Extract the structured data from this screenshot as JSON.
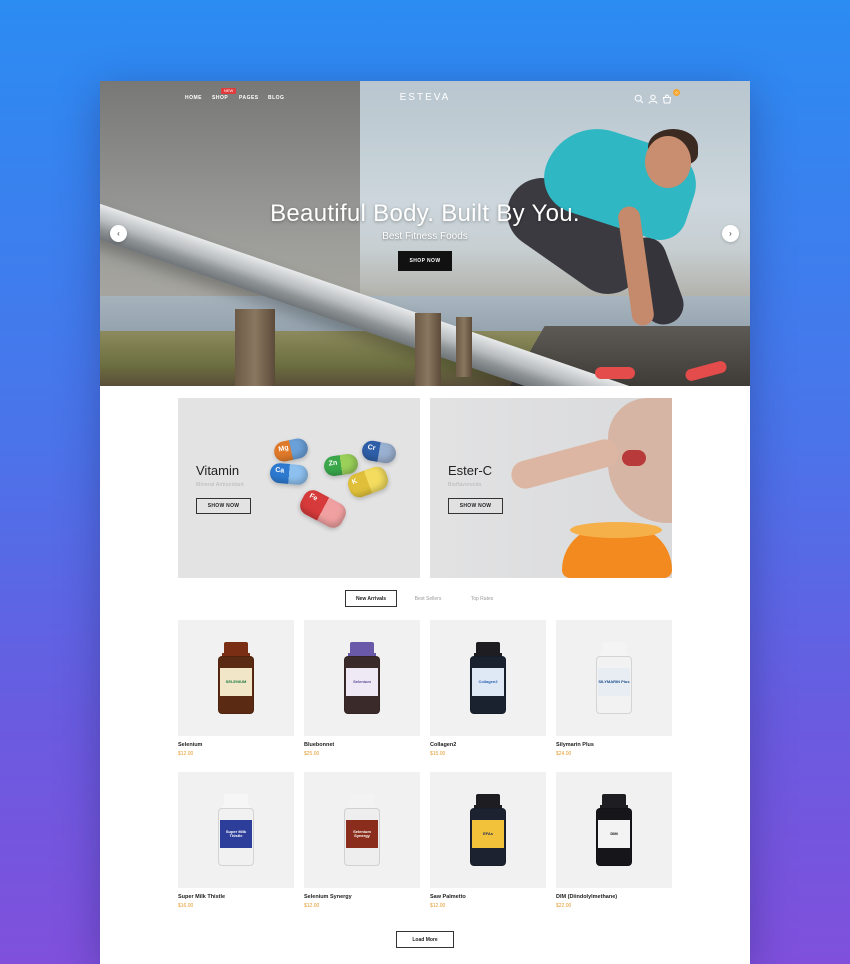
{
  "brand": "ESTEVA",
  "nav": {
    "items": [
      {
        "label": "HOME"
      },
      {
        "label": "SHOP",
        "badge": "NEW"
      },
      {
        "label": "PAGES"
      },
      {
        "label": "BLOG"
      }
    ],
    "icons": [
      "search-icon",
      "user-icon",
      "cart-icon"
    ],
    "cart_count": "0"
  },
  "hero": {
    "title": "Beautiful Body. Built By You.",
    "subtitle": "Best Fitness Foods",
    "button": "SHOP NOW",
    "prev_arrow": "‹",
    "next_arrow": "›"
  },
  "promos": [
    {
      "title": "Vitamin",
      "subtitle": "Mineral Antioxidant",
      "button": "SHOW NOW",
      "pill_labels": [
        "Ca",
        "Mg",
        "Zn",
        "Cr",
        "Fe",
        "K"
      ]
    },
    {
      "title": "Ester-C",
      "subtitle": "Bioflavonoids",
      "button": "SHOW NOW"
    }
  ],
  "tabs": [
    {
      "label": "New Arrivals",
      "active": true
    },
    {
      "label": "Best Sellers",
      "active": false
    },
    {
      "label": "Top Rates",
      "active": false
    }
  ],
  "products": [
    {
      "name": "Selenium",
      "price": "$12.00",
      "label": "SELENIUM",
      "cap": "#7a2f14",
      "body": "#5a2a12",
      "label_bg": "#f2e6c8",
      "label_color": "#1d7a43"
    },
    {
      "name": "Bluebonnet",
      "price": "$25.00",
      "label": "Selenium",
      "cap": "#6a58a8",
      "body": "#3b2a2a",
      "label_bg": "#efe9f5",
      "label_color": "#5b4a98"
    },
    {
      "name": "Collagen2",
      "price": "$15.00",
      "label": "Collagen2",
      "cap": "#1d1d22",
      "body": "#1a2230",
      "label_bg": "#dfe9f5",
      "label_color": "#2d63b6"
    },
    {
      "name": "Silymarin Plus",
      "price": "$24.00",
      "label": "SILYMARIN Plus",
      "cap": "#f4f4f4",
      "body": "#f2f2f2",
      "label_bg": "#e7edf3",
      "label_color": "#1e4f8c"
    },
    {
      "name": "Super Milk Thistle",
      "price": "$16.00",
      "label": "Super Milk Thistle",
      "cap": "#f6f6f6",
      "body": "#f1f1f1",
      "label_bg": "#2d3e9a",
      "label_color": "#ffffff"
    },
    {
      "name": "Selenium Synergy",
      "price": "$12.00",
      "label": "Selenium Synergy",
      "cap": "#f3f3f3",
      "body": "#eeeeee",
      "label_bg": "#8b2d1c",
      "label_color": "#ffffff"
    },
    {
      "name": "Saw Palmetto",
      "price": "$12.00",
      "label": "EFAs",
      "cap": "#1d1d22",
      "body": "#1c2230",
      "label_bg": "#f2c23a",
      "label_color": "#1d2a5a"
    },
    {
      "name": "DIM (Diindolylmethane)",
      "price": "$22.00",
      "label": "DIM",
      "cap": "#1d1d22",
      "body": "#15151a",
      "label_bg": "#f3f3f3",
      "label_color": "#111111"
    }
  ],
  "load_more": "Load More",
  "colors": {
    "accent": "#e49a2e",
    "badge": "#e23b3b",
    "dark": "#111111"
  }
}
